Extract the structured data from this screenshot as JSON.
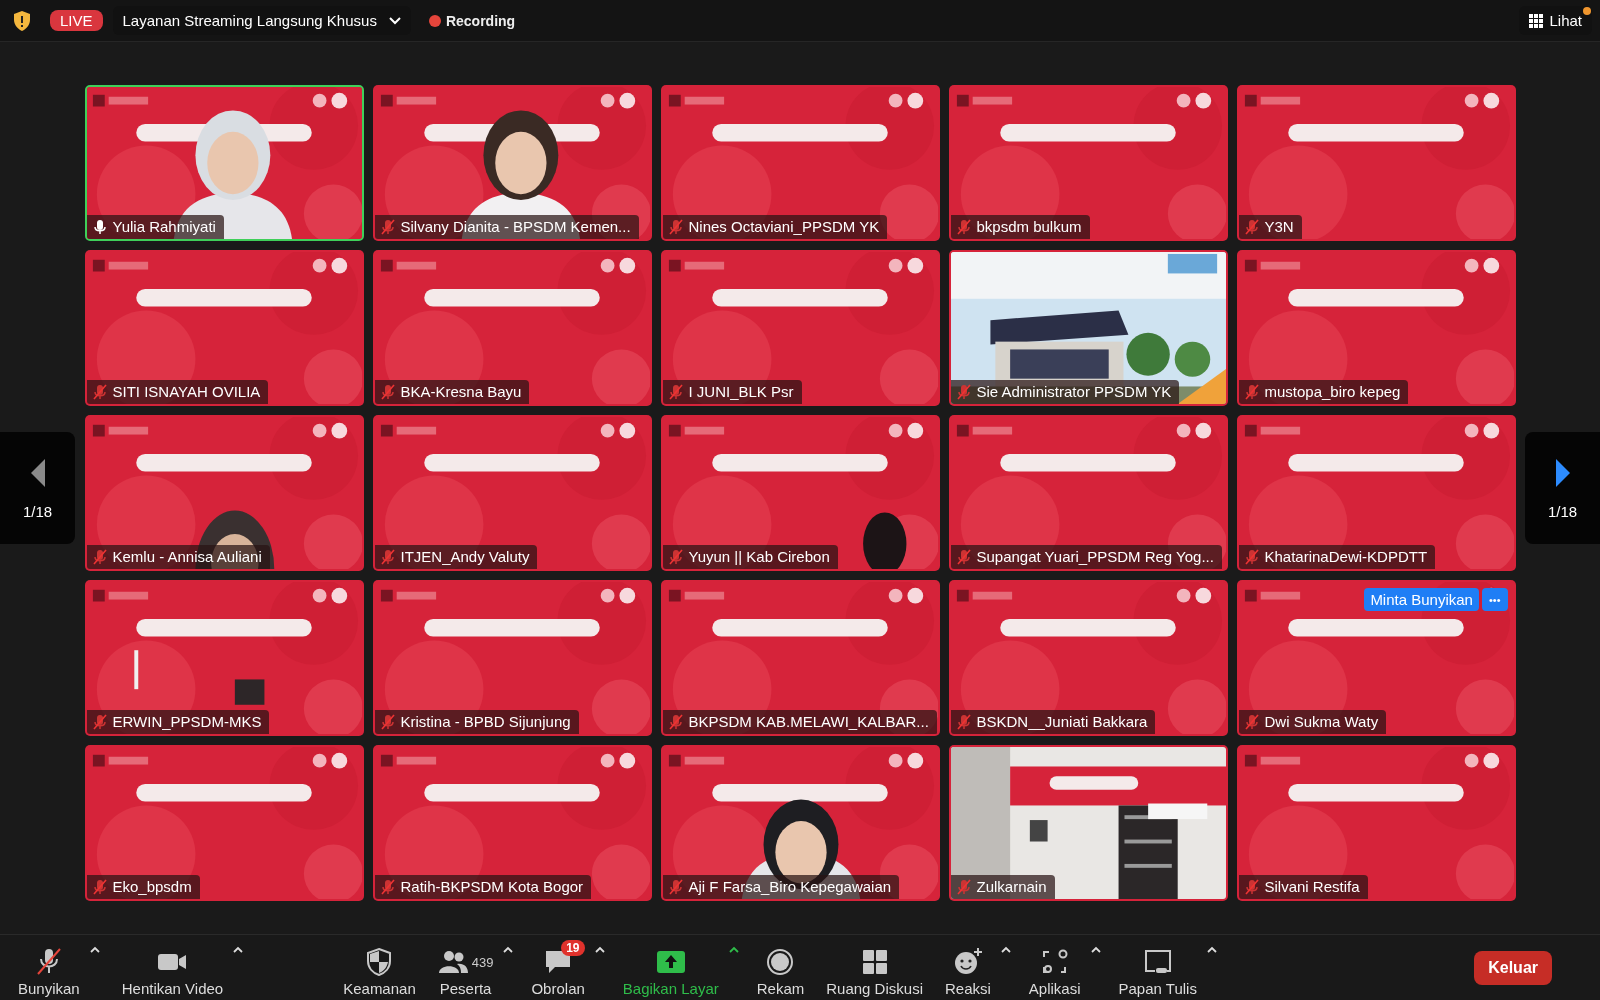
{
  "top_bar": {
    "live_badge": "LIVE",
    "stream_menu": "Layanan Streaming Langsung Khusus",
    "recording": "Recording",
    "view_button": {
      "label": "Lihat",
      "notification": true
    }
  },
  "pager_left": {
    "page": "1/18",
    "disabled": true
  },
  "pager_right": {
    "page": "1/18",
    "disabled": false
  },
  "tiles": [
    {
      "name": "Yulia Rahmiyati",
      "muted": false,
      "speaking": true
    },
    {
      "name": "Silvany Dianita - BPSDM Kemen...",
      "muted": true,
      "speaking": false
    },
    {
      "name": "Nines Octaviani_PPSDM YK",
      "muted": true,
      "speaking": false
    },
    {
      "name": "bkpsdm bulkum",
      "muted": true,
      "speaking": false
    },
    {
      "name": "Y3N",
      "muted": true,
      "speaking": false
    },
    {
      "name": "SITI ISNAYAH OVILIA",
      "muted": true,
      "speaking": false
    },
    {
      "name": "BKA-Kresna Bayu",
      "muted": true,
      "speaking": false
    },
    {
      "name": "I JUNI_BLK Psr",
      "muted": true,
      "speaking": false
    },
    {
      "name": "Sie Administrator PPSDM YK",
      "muted": true,
      "speaking": false
    },
    {
      "name": "mustopa_biro kepeg",
      "muted": true,
      "speaking": false
    },
    {
      "name": "Kemlu - Annisa Auliani",
      "muted": true,
      "speaking": false
    },
    {
      "name": "ITJEN_Andy Valuty",
      "muted": true,
      "speaking": false
    },
    {
      "name": "Yuyun || Kab Cirebon",
      "muted": true,
      "speaking": false
    },
    {
      "name": "Supangat Yuari_PPSDM Reg Yog...",
      "muted": true,
      "speaking": false
    },
    {
      "name": "KhatarinaDewi-KDPDTT",
      "muted": true,
      "speaking": false
    },
    {
      "name": "ERWIN_PPSDM-MKS",
      "muted": true,
      "speaking": false
    },
    {
      "name": "Kristina - BPBD Sijunjung",
      "muted": true,
      "speaking": false
    },
    {
      "name": "BKPSDM KAB.MELAWI_KALBAR...",
      "muted": true,
      "speaking": false
    },
    {
      "name": "BSKDN__Juniati Bakkara",
      "muted": true,
      "speaking": false
    },
    {
      "name": "Dwi Sukma Waty",
      "muted": true,
      "speaking": false
    },
    {
      "name": "Eko_bpsdm",
      "muted": true,
      "speaking": false
    },
    {
      "name": "Ratih-BKPSDM Kota Bogor",
      "muted": true,
      "speaking": false
    },
    {
      "name": "Aji F Farsa_Biro Kepegawaian",
      "muted": true,
      "speaking": false
    },
    {
      "name": "Zulkarnain",
      "muted": true,
      "speaking": false
    },
    {
      "name": "Silvani Restifa",
      "muted": true,
      "speaking": false
    }
  ],
  "tile_hover_actions": {
    "request": "Minta Bunyikan",
    "more": "•••"
  },
  "toolbar": {
    "left": [
      {
        "kind": "mic",
        "label": "Bunyikan",
        "caret": true,
        "muted": true
      },
      {
        "kind": "video",
        "label": "Hentikan Video",
        "caret": true
      }
    ],
    "center": [
      {
        "kind": "shield",
        "label": "Keamanan",
        "caret": false
      },
      {
        "kind": "people",
        "label": "Peserta",
        "count": "439",
        "caret": true
      },
      {
        "kind": "chat",
        "label": "Obrolan",
        "badge": "19",
        "caret": true
      },
      {
        "kind": "share",
        "label": "Bagikan Layar",
        "caret": true,
        "active": true
      },
      {
        "kind": "record",
        "label": "Rekam",
        "caret": false
      },
      {
        "kind": "rooms",
        "label": "Ruang Diskusi",
        "caret": false
      },
      {
        "kind": "reaction",
        "label": "Reaksi",
        "caret": true
      },
      {
        "kind": "apps",
        "label": "Aplikasi",
        "caret": true
      },
      {
        "kind": "whiteboard",
        "label": "Papan Tulis",
        "caret": true
      }
    ],
    "leave_button": "Keluar"
  }
}
